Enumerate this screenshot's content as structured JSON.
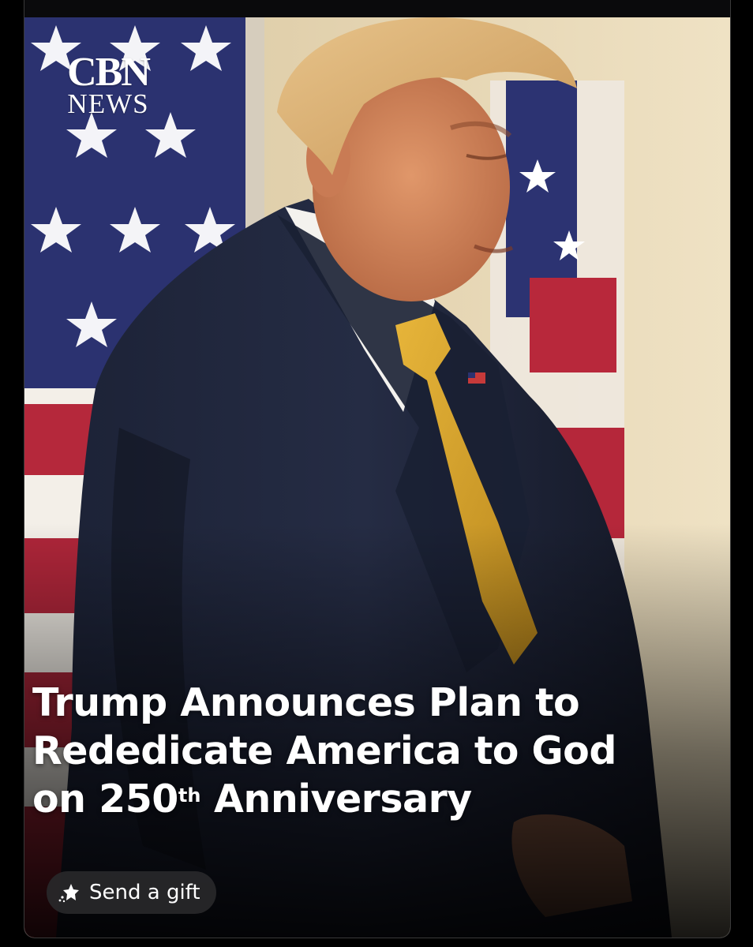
{
  "post": {
    "logo": {
      "line1": "CBN",
      "line2": "NEWS"
    },
    "headline": {
      "line1": "Trump Announces Plan to",
      "line2": "Rededicate America to God",
      "line3_pre": "on 250",
      "line3_sup": "th",
      "line3_post": " Anniversary"
    }
  },
  "actions": {
    "send_gift_label": "Send a gift",
    "send_gift_icon": "gift-sparkle-icon"
  },
  "colors": {
    "background": "#000000",
    "card_border": "#3a3a3a",
    "gift_pill": "#28282a",
    "text": "#ffffff"
  }
}
